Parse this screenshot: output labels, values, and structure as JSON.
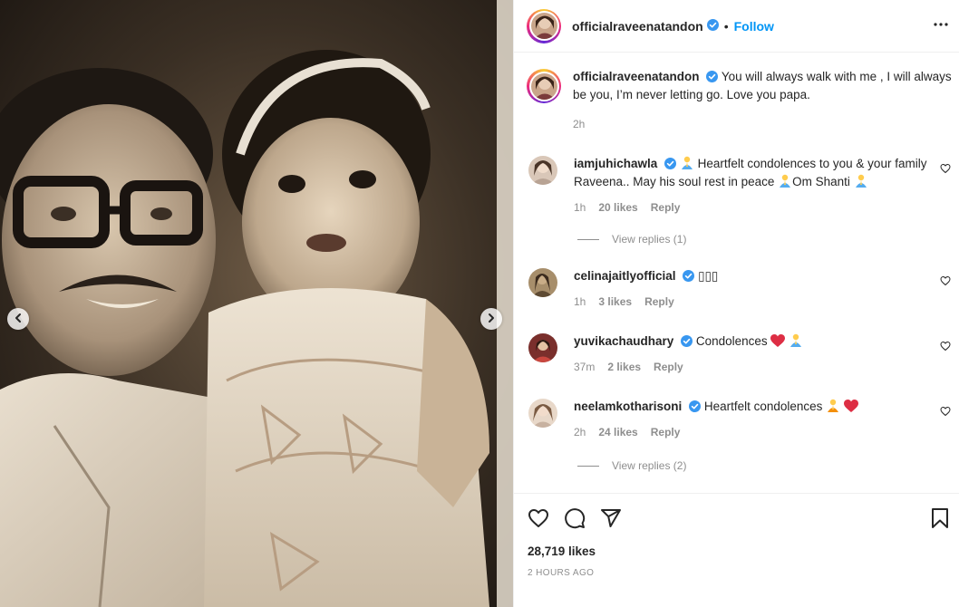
{
  "post": {
    "username": "officialraveenatandon",
    "follow_label": "Follow",
    "separator": "•",
    "caption": "You will always walk with me , I will always be you, I’m never letting go. Love you papa.",
    "caption_time": "2h"
  },
  "comments": [
    {
      "username": "iamjuhichawla",
      "verified": true,
      "text_a": "Heartfelt condolences to you & your family Raveena.. May his soul rest in peace",
      "text_b": "Om Shanti",
      "time": "1h",
      "likes": "20 likes",
      "reply": "Reply",
      "view_replies": "View replies (1)"
    },
    {
      "username": "celinajaitlyofficial",
      "verified": true,
      "text": "▯▯▯",
      "time": "1h",
      "likes": "3 likes",
      "reply": "Reply"
    },
    {
      "username": "yuvikachaudhary",
      "verified": true,
      "text": "Condolences",
      "time": "37m",
      "likes": "2 likes",
      "reply": "Reply"
    },
    {
      "username": "neelamkotharisoni",
      "verified": true,
      "text": "Heartfelt condolences",
      "time": "2h",
      "likes": "24 likes",
      "reply": "Reply",
      "view_replies": "View replies (2)"
    }
  ],
  "footer": {
    "likes": "28,719 likes",
    "timestamp": "2 HOURS AGO"
  },
  "icons": {
    "verified": "verified-badge-icon",
    "more": "more-options-icon",
    "like": "heart-icon",
    "comment": "comment-icon",
    "share": "share-icon",
    "save": "bookmark-icon",
    "prev": "chevron-left-icon",
    "next": "chevron-right-icon"
  },
  "colors": {
    "accent": "#0095f6",
    "verified": "#3897f0",
    "secondary_text": "#8e8e8e",
    "heart_red": "#ed4956"
  }
}
